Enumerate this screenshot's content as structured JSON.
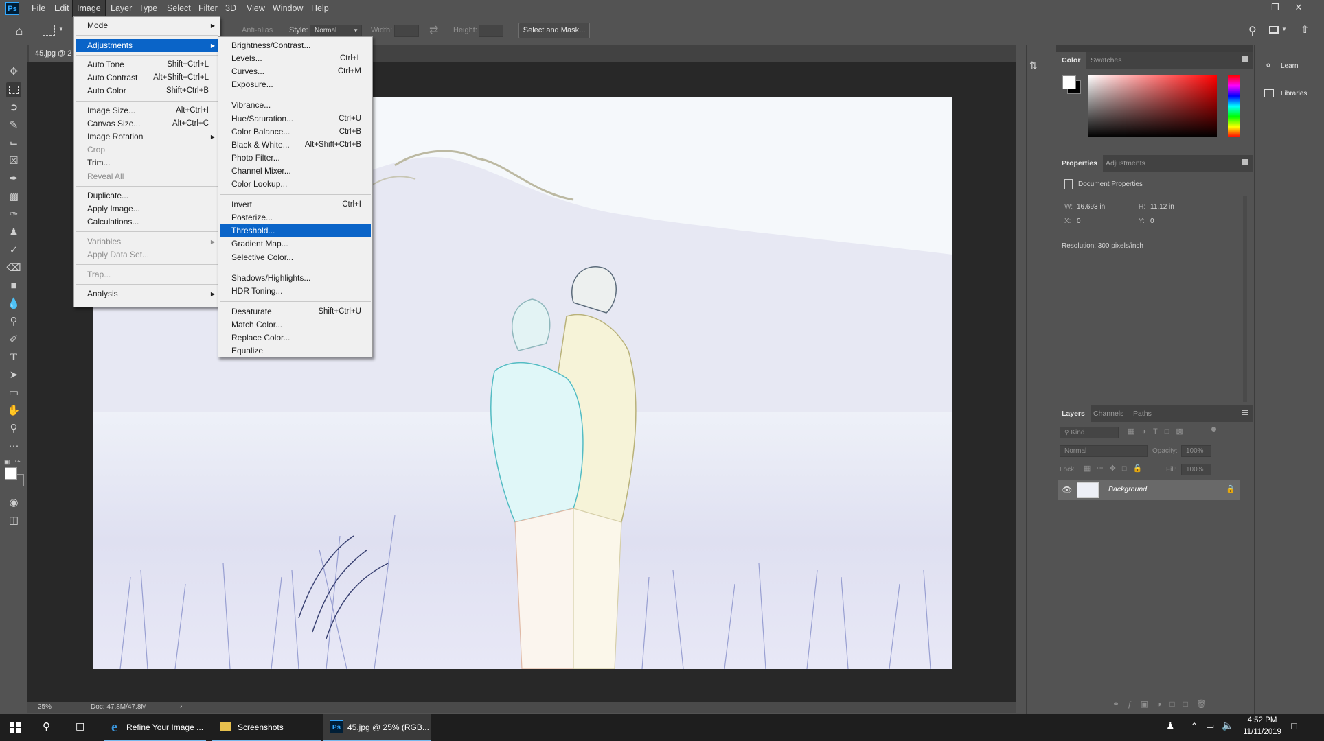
{
  "app": {
    "logo": "Ps"
  },
  "menubar": {
    "items": [
      "File",
      "Edit",
      "Image",
      "Layer",
      "Type",
      "Select",
      "Filter",
      "3D",
      "View",
      "Window",
      "Help"
    ],
    "active": "Image"
  },
  "options_bar": {
    "anti_alias": "Anti-alias",
    "style_label": "Style:",
    "style_value": "Normal",
    "width_label": "Width:",
    "height_label": "Height:",
    "select_and_mask": "Select and Mask..."
  },
  "document": {
    "tab_label": "45.jpg @ 2",
    "zoom": "25%",
    "doc_size": "Doc: 47.8M/47.8M"
  },
  "image_menu": [
    {
      "label": "Mode",
      "submenu": true
    },
    {
      "sep": true
    },
    {
      "label": "Adjustments",
      "submenu": true,
      "highlight": true
    },
    {
      "sep": true
    },
    {
      "label": "Auto Tone",
      "shortcut": "Shift+Ctrl+L"
    },
    {
      "label": "Auto Contrast",
      "shortcut": "Alt+Shift+Ctrl+L"
    },
    {
      "label": "Auto Color",
      "shortcut": "Shift+Ctrl+B"
    },
    {
      "sep": true
    },
    {
      "label": "Image Size...",
      "shortcut": "Alt+Ctrl+I"
    },
    {
      "label": "Canvas Size...",
      "shortcut": "Alt+Ctrl+C"
    },
    {
      "label": "Image Rotation",
      "submenu": true
    },
    {
      "label": "Crop",
      "disabled": true
    },
    {
      "label": "Trim..."
    },
    {
      "label": "Reveal All",
      "disabled": true
    },
    {
      "sep": true
    },
    {
      "label": "Duplicate..."
    },
    {
      "label": "Apply Image..."
    },
    {
      "label": "Calculations..."
    },
    {
      "sep": true
    },
    {
      "label": "Variables",
      "submenu": true,
      "disabled": true
    },
    {
      "label": "Apply Data Set...",
      "disabled": true
    },
    {
      "sep": true
    },
    {
      "label": "Trap...",
      "disabled": true
    },
    {
      "sep": true
    },
    {
      "label": "Analysis",
      "submenu": true
    }
  ],
  "adjustments_menu": [
    {
      "label": "Brightness/Contrast..."
    },
    {
      "label": "Levels...",
      "shortcut": "Ctrl+L"
    },
    {
      "label": "Curves...",
      "shortcut": "Ctrl+M"
    },
    {
      "label": "Exposure..."
    },
    {
      "sep": true
    },
    {
      "label": "Vibrance..."
    },
    {
      "label": "Hue/Saturation...",
      "shortcut": "Ctrl+U"
    },
    {
      "label": "Color Balance...",
      "shortcut": "Ctrl+B"
    },
    {
      "label": "Black & White...",
      "shortcut": "Alt+Shift+Ctrl+B"
    },
    {
      "label": "Photo Filter..."
    },
    {
      "label": "Channel Mixer..."
    },
    {
      "label": "Color Lookup..."
    },
    {
      "sep": true
    },
    {
      "label": "Invert",
      "shortcut": "Ctrl+I"
    },
    {
      "label": "Posterize..."
    },
    {
      "label": "Threshold...",
      "highlight": true
    },
    {
      "label": "Gradient Map..."
    },
    {
      "label": "Selective Color..."
    },
    {
      "sep": true
    },
    {
      "label": "Shadows/Highlights..."
    },
    {
      "label": "HDR Toning..."
    },
    {
      "sep": true
    },
    {
      "label": "Desaturate",
      "shortcut": "Shift+Ctrl+U"
    },
    {
      "label": "Match Color..."
    },
    {
      "label": "Replace Color..."
    },
    {
      "label": "Equalize"
    }
  ],
  "color_panel": {
    "tabs": [
      "Color",
      "Swatches"
    ],
    "foreground": "#ffffff",
    "background": "#000000",
    "hue": "#ff0000"
  },
  "properties_panel": {
    "tabs": [
      "Properties",
      "Adjustments"
    ],
    "title": "Document Properties",
    "w_label": "W:",
    "w_value": "16.693 in",
    "h_label": "H:",
    "h_value": "11.12 in",
    "x_label": "X:",
    "x_value": "0",
    "y_label": "Y:",
    "y_value": "0",
    "resolution": "Resolution: 300 pixels/inch"
  },
  "layers_panel": {
    "tabs": [
      "Layers",
      "Channels",
      "Paths"
    ],
    "kind_placeholder": "Kind",
    "blend_mode": "Normal",
    "opacity_label": "Opacity:",
    "opacity_value": "100%",
    "lock_label": "Lock:",
    "fill_label": "Fill:",
    "fill_value": "100%",
    "layers": [
      {
        "name": "Background",
        "visible": true,
        "locked": true
      }
    ]
  },
  "right_dock": {
    "learn": "Learn",
    "libraries": "Libraries"
  },
  "taskbar": {
    "apps": [
      {
        "label": "Refine Your Image ...",
        "icon": "edge-icon"
      },
      {
        "label": "Screenshots",
        "icon": "folder-icon"
      },
      {
        "label": "45.jpg @ 25% (RGB...",
        "icon": "photoshop-icon",
        "active": true
      }
    ],
    "time": "4:52 PM",
    "date": "11/11/2019"
  }
}
